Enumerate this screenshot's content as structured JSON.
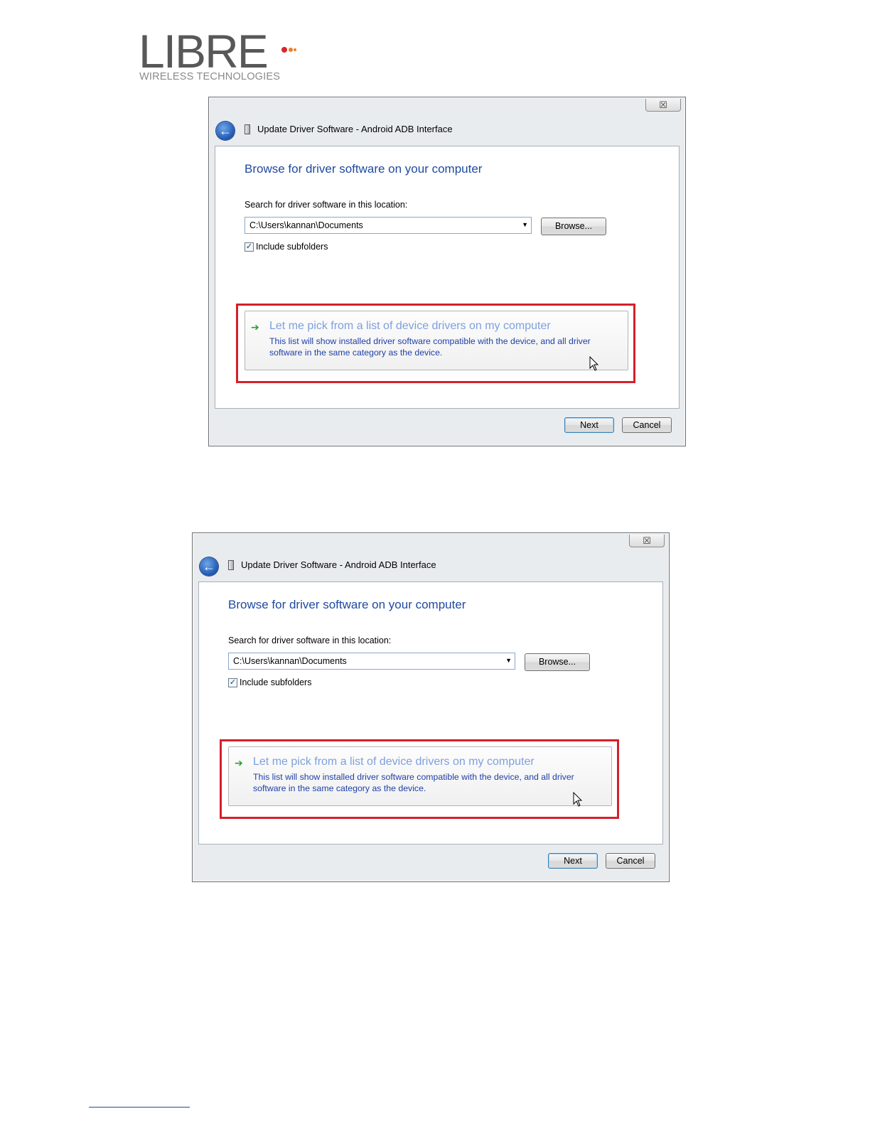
{
  "logo": {
    "wordmark": "LIBRE",
    "tagline": "WIRELESS TECHNOLOGIES",
    "dot_colors": [
      "#d8252c",
      "#ef7d22",
      "#ef7d22"
    ]
  },
  "dialogs": [
    {
      "close_label": "☒",
      "window_title": "Update Driver Software - Android ADB Interface",
      "heading": "Browse for driver software on your computer",
      "search_label": "Search for driver software in this location:",
      "path_value": "C:\\Users\\kannan\\Documents",
      "browse_label": "Browse...",
      "include_subfolders_label": "Include subfolders",
      "include_subfolders_checked": true,
      "option_title": "Let me pick from a list of device drivers on my computer",
      "option_desc": "This list will show installed driver software compatible with the device, and all driver software in the same category as the device.",
      "next_label": "Next",
      "cancel_label": "Cancel"
    },
    {
      "close_label": "☒",
      "window_title": "Update Driver Software - Android ADB Interface",
      "heading": "Browse for driver software on your computer",
      "search_label": "Search for driver software in this location:",
      "path_value": "C:\\Users\\kannan\\Documents",
      "browse_label": "Browse...",
      "include_subfolders_label": "Include subfolders",
      "include_subfolders_checked": true,
      "option_title": "Let me pick from a list of device drivers on my computer",
      "option_desc": "This list will show installed driver software compatible with the device, and all driver software in the same category as the device.",
      "next_label": "Next",
      "cancel_label": "Cancel"
    }
  ],
  "icons": {
    "back": "back-arrow-icon",
    "device": "device-icon",
    "option_arrow": "green-arrow-icon",
    "close": "close-icon",
    "dropdown": "chevron-down-icon",
    "cursor": "mouse-cursor-icon"
  },
  "colors": {
    "heading": "#1f4aa0",
    "highlight_box": "#d4202c",
    "option_title": "#7ea0dc",
    "option_desc": "#1f3fa8"
  }
}
